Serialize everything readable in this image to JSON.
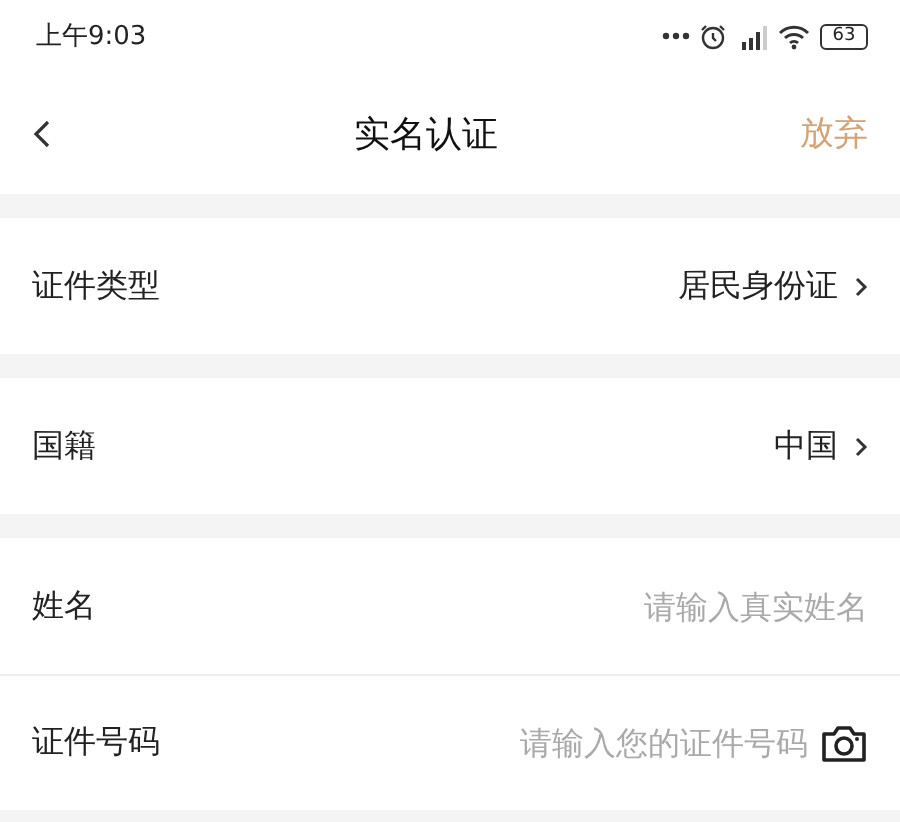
{
  "status_bar": {
    "time": "上午9:03",
    "battery": "63"
  },
  "nav_bar": {
    "title": "实名认证",
    "action": "放弃"
  },
  "sections": [
    {
      "rows": [
        {
          "kind": "select",
          "label": "证件类型",
          "value": "居民身份证"
        }
      ]
    },
    {
      "rows": [
        {
          "kind": "select",
          "label": "国籍",
          "value": "中国"
        }
      ]
    },
    {
      "rows": [
        {
          "kind": "text",
          "label": "姓名",
          "placeholder": "请输入真实姓名"
        },
        {
          "kind": "scan",
          "label": "证件号码",
          "placeholder": "请输入您的证件号码"
        }
      ]
    }
  ]
}
